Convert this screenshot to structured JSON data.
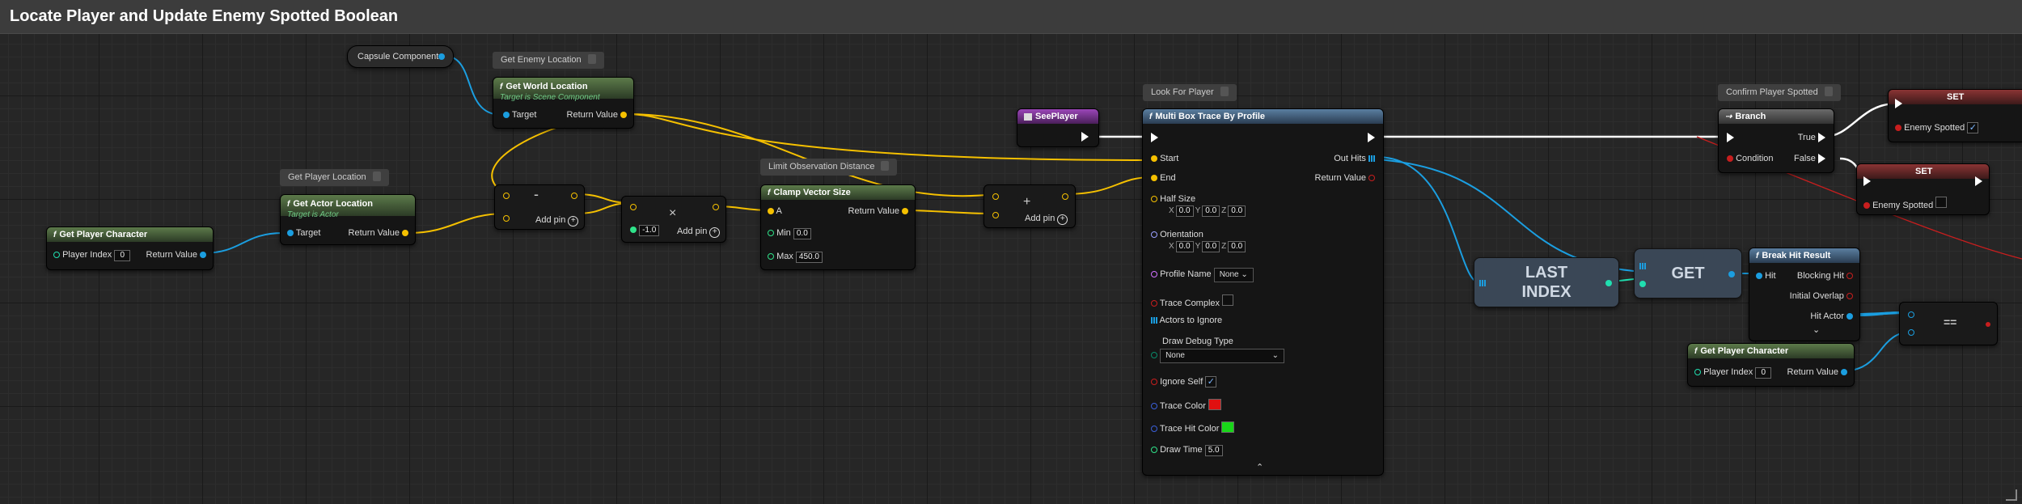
{
  "comment_title": "Locate Player and Update Enemy Spotted Boolean",
  "tags": {
    "get_enemy_location": "Get Enemy Location",
    "get_player_location": "Get Player Location",
    "limit_observation": "Limit Observation Distance",
    "look_for_player": "Look For Player",
    "confirm_spotted": "Confirm Player Spotted"
  },
  "capsule": {
    "label": "Capsule Component"
  },
  "get_world_location": {
    "title": "Get World Location",
    "subtitle": "Target is Scene Component",
    "target": "Target",
    "ret": "Return Value"
  },
  "get_player_character_1": {
    "title": "Get Player Character",
    "player_index": "Player Index",
    "index_value": "0",
    "ret": "Return Value"
  },
  "get_actor_location": {
    "title": "Get Actor Location",
    "subtitle": "Target is Actor",
    "target": "Target",
    "ret": "Return Value"
  },
  "subtract": {
    "symbol": "-",
    "add_pin": "Add pin"
  },
  "multiply": {
    "symbol": "×",
    "value": "-1.0",
    "add_pin": "Add pin"
  },
  "clamp": {
    "title": "Clamp Vector Size",
    "a": "A",
    "min": "Min",
    "min_value": "0.0",
    "max": "Max",
    "max_value": "450.0",
    "ret": "Return Value"
  },
  "add": {
    "symbol": "+",
    "add_pin": "Add pin"
  },
  "see_player": {
    "title": "SeePlayer"
  },
  "trace": {
    "title": "Multi Box Trace By Profile",
    "start": "Start",
    "end": "End",
    "out_hits": "Out Hits",
    "ret": "Return Value",
    "half_size": "Half Size",
    "half_size_x": "0.0",
    "half_size_y": "0.0",
    "half_size_z": "0.0",
    "orientation": "Orientation",
    "orient_x": "0.0",
    "orient_y": "0.0",
    "orient_z": "0.0",
    "axis_x": "X",
    "axis_y": "Y",
    "axis_z": "Z",
    "profile_name": "Profile Name",
    "profile_value": "None",
    "trace_complex": "Trace Complex",
    "actors_to_ignore": "Actors to Ignore",
    "draw_debug_type": "Draw Debug Type",
    "draw_debug_value": "None",
    "ignore_self": "Ignore Self",
    "trace_color": "Trace Color",
    "trace_color_hex": "#e01010",
    "trace_hit_color": "Trace Hit Color",
    "trace_hit_color_hex": "#19d619",
    "draw_time": "Draw Time",
    "draw_time_value": "5.0"
  },
  "last_index": {
    "line1": "LAST",
    "line2": "INDEX"
  },
  "get": {
    "label": "GET"
  },
  "break_hit": {
    "title": "Break Hit Result",
    "hit": "Hit",
    "blocking_hit": "Blocking Hit",
    "initial_overlap": "Initial Overlap",
    "hit_actor": "Hit Actor"
  },
  "branch": {
    "title": "Branch",
    "condition": "Condition",
    "true": "True",
    "false": "False"
  },
  "set_true": {
    "title": "SET",
    "var": "Enemy Spotted"
  },
  "set_false": {
    "title": "SET",
    "var": "Enemy Spotted"
  },
  "get_player_character_2": {
    "title": "Get Player Character",
    "player_index": "Player Index",
    "index_value": "0",
    "ret": "Return Value"
  },
  "equals": {
    "symbol": "=="
  },
  "icons": {
    "function": "f",
    "plus": "+",
    "check": "✓",
    "chevron_down": "⌄",
    "chevron_up": "⌃"
  }
}
